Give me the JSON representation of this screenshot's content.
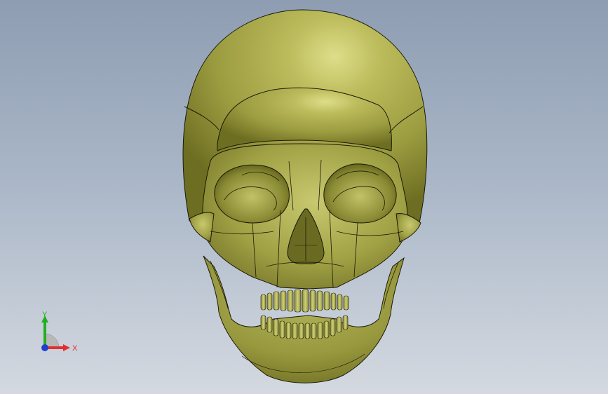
{
  "viewport": {
    "background_top": "#8e9db2",
    "background_bottom": "#d4d9e0"
  },
  "model": {
    "color": "#a8a84a",
    "edge_color": "#1a1a0a"
  },
  "triad": {
    "x_label": "X",
    "y_label": "Y",
    "x_color": "#e03030",
    "y_color": "#20b020",
    "z_color": "#2040d0"
  }
}
